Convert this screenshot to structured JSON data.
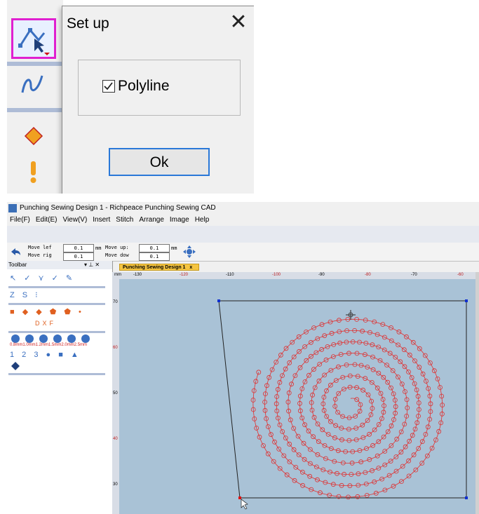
{
  "dialog": {
    "title": "Set up",
    "close_glyph": "✕",
    "checkbox_label": "Polyline",
    "checkbox_checked": true,
    "ok_label": "Ok"
  },
  "mini_toolbar": {
    "icons": [
      "polyline-tool-icon",
      "curve-tool-icon",
      "diamond-shape-icon",
      "exclamation-icon"
    ],
    "active_color": "#e020d0"
  },
  "window": {
    "title": "Punching Sewing Design 1 - Richpeace Punching Sewing CAD",
    "menu": [
      "File(F)",
      "Edit(E)",
      "View(V)",
      "Insert",
      "Stitch",
      "Arrange",
      "Image",
      "Help"
    ]
  },
  "move_bar": {
    "move_left_label": "Move lef",
    "move_right_label": "Move rig",
    "move_up_label": "Move up:",
    "move_down_label": "Move dow",
    "move_left_value": "0.1",
    "move_right_value": "0.1",
    "move_up_value": "0.1",
    "move_down_value": "0.1",
    "unit_1": "mm",
    "unit_2": "mm"
  },
  "toolbar_panel": {
    "title": "Toolbar",
    "pin_glyphs": "▾ ⊥ ✕",
    "row1": "↖ ✓ ⋎ ✓ ✎",
    "row2": "Z S ⁝",
    "row3": "■ ◆ ◆ ⬟ ⬟ •",
    "row4_text": "DXF",
    "size_labels": "0.8mm1.0mm1.2mm1.5mm2.0mm2.5mm",
    "row6": "1 2 3 ● ■ ▲",
    "accent": "#3a6fc0"
  },
  "document": {
    "tab_label": "Punching Sewing Design 1",
    "tab_close": "x",
    "ruler_unit": "mm",
    "ruler_ticks": [
      "-130",
      "-120",
      "-110",
      "-100",
      "-90",
      "-80",
      "-70",
      "-60"
    ],
    "left_ruler_ticks": [
      "70",
      "60",
      "50",
      "40",
      "30"
    ],
    "canvas_color": "#a9c2d6",
    "stitch_color": "#e03030"
  }
}
